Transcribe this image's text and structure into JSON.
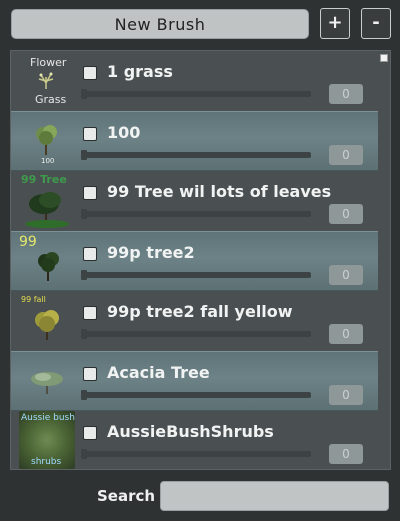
{
  "header": {
    "new_brush_label": "New Brush",
    "add_label": "+",
    "remove_label": "-"
  },
  "brushes": [
    {
      "label": "1 grass",
      "value": "0",
      "checked": false,
      "thumb_top": "Flower",
      "thumb_bottom": "Grass"
    },
    {
      "label": "100",
      "value": "0",
      "checked": false,
      "thumb_caption": "100"
    },
    {
      "label": "99 Tree wil lots of leaves",
      "value": "0",
      "checked": false,
      "thumb_caption": "99 Tree"
    },
    {
      "label": "99p tree2",
      "value": "0",
      "checked": false,
      "thumb_caption": "99"
    },
    {
      "label": "99p tree2 fall yellow",
      "value": "0",
      "checked": false,
      "thumb_caption": "99 fall"
    },
    {
      "label": "Acacia Tree",
      "value": "0",
      "checked": false
    },
    {
      "label": "AussieBushShrubs",
      "value": "0",
      "checked": false,
      "thumb_top": "Aussie bush",
      "thumb_bottom": "shrubs"
    }
  ],
  "footer": {
    "search_label": "Search",
    "search_value": ""
  },
  "colors": {
    "background": "#2f3233",
    "list_bg": "#4a5052",
    "alt_row": "#6c8286",
    "button_light": "#bfc3c4"
  }
}
